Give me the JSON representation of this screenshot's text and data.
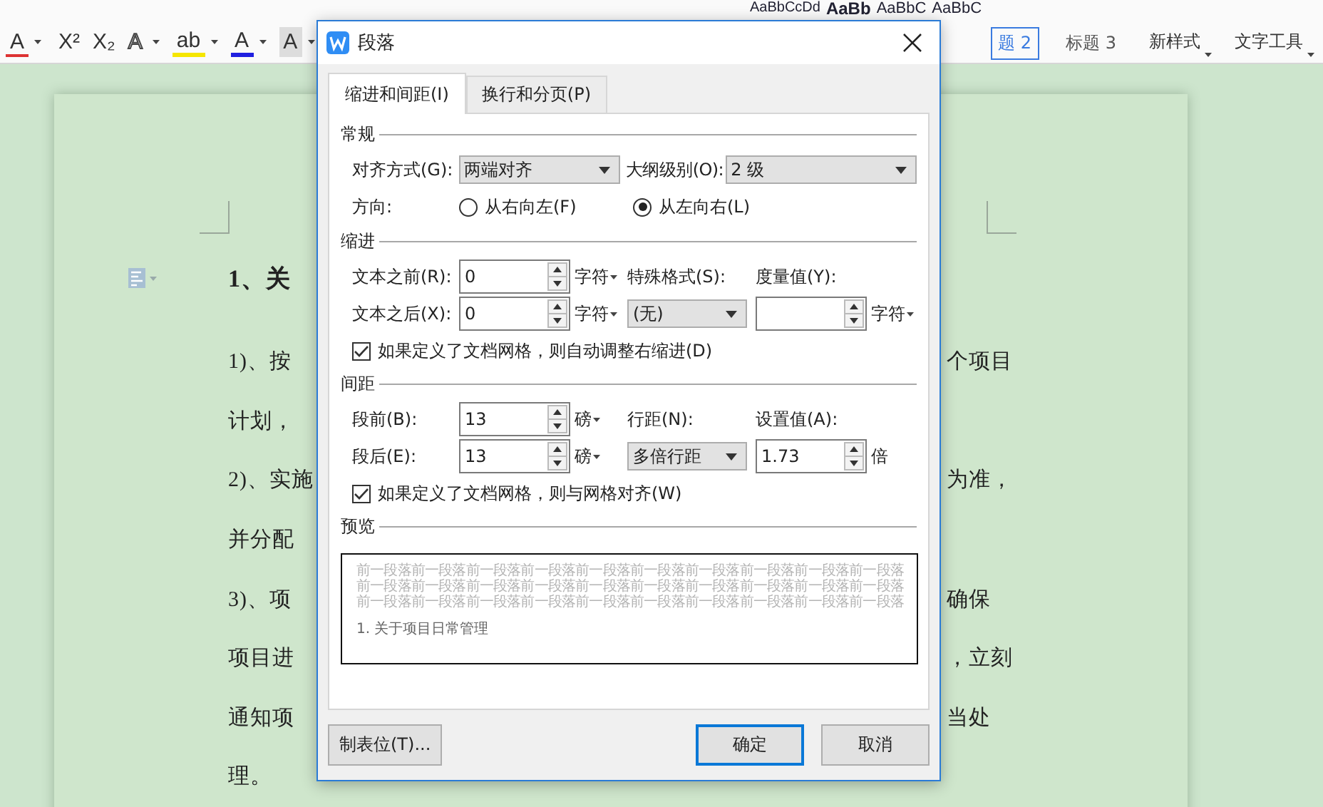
{
  "toolbar": {
    "format_buttons": [
      {
        "label": "A",
        "kind": "strike"
      },
      {
        "label": "X²",
        "kind": "plain"
      },
      {
        "label": "X₂",
        "kind": "plain"
      },
      {
        "label": "A",
        "kind": "outline"
      },
      {
        "label": "ab",
        "kind": "highlight"
      },
      {
        "label": "A",
        "kind": "color"
      },
      {
        "label": "A",
        "kind": "shade"
      }
    ],
    "style_samples": [
      {
        "sample": "AaBbCcDd",
        "kind": "small"
      },
      {
        "sample": "AaBb",
        "kind": "big"
      },
      {
        "sample": "AaBbC",
        "kind": "mid"
      },
      {
        "sample": "AaBbC",
        "kind": "mid"
      }
    ],
    "style_labels": [
      {
        "label": "题 2",
        "selected": true
      },
      {
        "label": "标题 3",
        "selected": false
      }
    ],
    "new_style": "新样式",
    "text_tools": "文字工具"
  },
  "document": {
    "lines": [
      {
        "left": "1、关",
        "kind": "heading"
      },
      {
        "left": "1)、按",
        "right": "个项目",
        "kind": "body"
      },
      {
        "left": "计划，",
        "kind": "body"
      },
      {
        "left": "2)、实施",
        "right": "为准，",
        "kind": "body"
      },
      {
        "left": "并分配",
        "kind": "body"
      },
      {
        "left": "3)、项",
        "right": "确保",
        "kind": "body"
      },
      {
        "left": "项目进",
        "right": "，立刻",
        "kind": "body"
      },
      {
        "left": "通知项",
        "right": "当处",
        "kind": "body"
      },
      {
        "left": "理。",
        "kind": "body"
      }
    ]
  },
  "dialog": {
    "title": "段落",
    "tabs": [
      {
        "label": "缩进和间距(I)",
        "selected": true
      },
      {
        "label": "换行和分页(P)",
        "selected": false
      }
    ],
    "general": {
      "title": "常规",
      "alignment": {
        "label": "对齐方式(G):",
        "value": "两端对齐"
      },
      "outline": {
        "label": "大纲级别(O):",
        "value": "2 级"
      },
      "direction": {
        "label": "方向:",
        "options": [
          {
            "label": "从右向左(F)",
            "selected": false
          },
          {
            "label": "从左向右(L)",
            "selected": true
          }
        ]
      }
    },
    "indent": {
      "title": "缩进",
      "before": {
        "label": "文本之前(R):",
        "value": "0",
        "unit": "字符"
      },
      "after": {
        "label": "文本之后(X):",
        "value": "0",
        "unit": "字符"
      },
      "special": {
        "label": "特殊格式(S):",
        "value": "(无)"
      },
      "measure": {
        "label": "度量值(Y):",
        "unit": "字符"
      },
      "grid_check": {
        "label": "如果定义了文档网格，则自动调整右缩进(D)",
        "checked": true
      }
    },
    "spacing": {
      "title": "间距",
      "before": {
        "label": "段前(B):",
        "value": "13",
        "unit": "磅"
      },
      "after": {
        "label": "段后(E):",
        "value": "13",
        "unit": "磅"
      },
      "line": {
        "label": "行距(N):",
        "value": "多倍行距"
      },
      "setting": {
        "label": "设置值(A):",
        "value": "1.73",
        "unit": "倍"
      },
      "grid_check": {
        "label": "如果定义了文档网格，则与网格对齐(W)",
        "checked": true
      }
    },
    "preview": {
      "title": "预览",
      "ghost_lines": [
        "前一段落前一段落前一段落前一段落前一段落前一段落前一段落前一段落前一段落前一段落",
        "前一段落前一段落前一段落前一段落前一段落前一段落前一段落前一段落前一段落前一段落",
        "前一段落前一段落前一段落前一段落前一段落前一段落前一段落前一段落前一段落前一段落"
      ],
      "sample": "1. 关于项目日常管理"
    },
    "buttons": [
      {
        "label": "制表位(T)...",
        "kind": "left",
        "focused": false
      },
      {
        "label": "确定",
        "kind": "right",
        "focused": true
      },
      {
        "label": "取消",
        "kind": "right",
        "focused": false
      }
    ]
  }
}
